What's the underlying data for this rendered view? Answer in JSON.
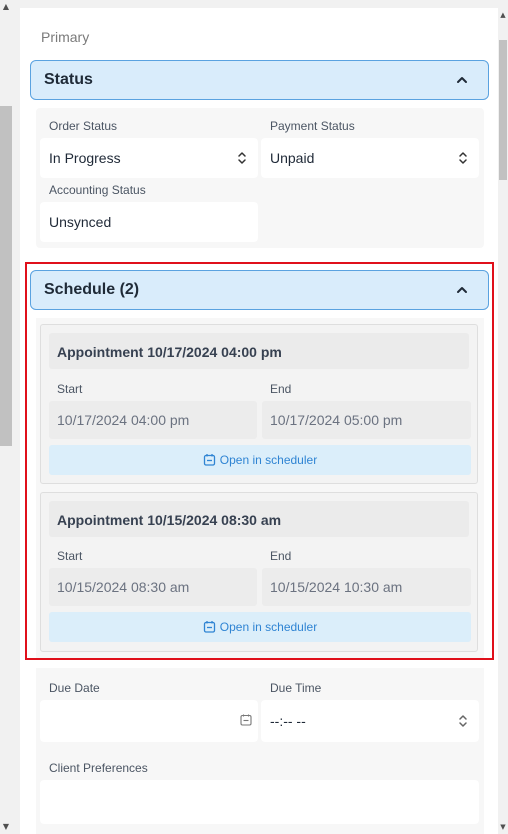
{
  "section_label": "Primary",
  "status": {
    "title": "Status",
    "order_status": {
      "label": "Order Status",
      "value": "In Progress"
    },
    "payment_status": {
      "label": "Payment Status",
      "value": "Unpaid"
    },
    "accounting_status": {
      "label": "Accounting Status",
      "value": "Unsynced"
    }
  },
  "schedule": {
    "title": "Schedule (2)",
    "appointments": [
      {
        "title": "Appointment 10/17/2024 04:00 pm",
        "start_label": "Start",
        "start_value": "10/17/2024 04:00 pm",
        "end_label": "End",
        "end_value": "10/17/2024 05:00 pm",
        "open_label": "Open in scheduler"
      },
      {
        "title": "Appointment 10/15/2024 08:30 am",
        "start_label": "Start",
        "start_value": "10/15/2024 08:30 am",
        "end_label": "End",
        "end_value": "10/15/2024 10:30 am",
        "open_label": "Open in scheduler"
      }
    ]
  },
  "due_date": {
    "label": "Due Date",
    "value": ""
  },
  "due_time": {
    "label": "Due Time",
    "value": "--:-- --"
  },
  "client_preferences": {
    "label": "Client Preferences",
    "value": ""
  },
  "icons": {
    "collapse": "chevron-up-icon",
    "select": "up-down-chevron-icon",
    "calendar": "calendar-icon"
  },
  "colors": {
    "accent": "#2f84d3",
    "header_bg": "#d9ecfb",
    "header_border": "#5aa2e0",
    "highlight": "#e0101b"
  }
}
